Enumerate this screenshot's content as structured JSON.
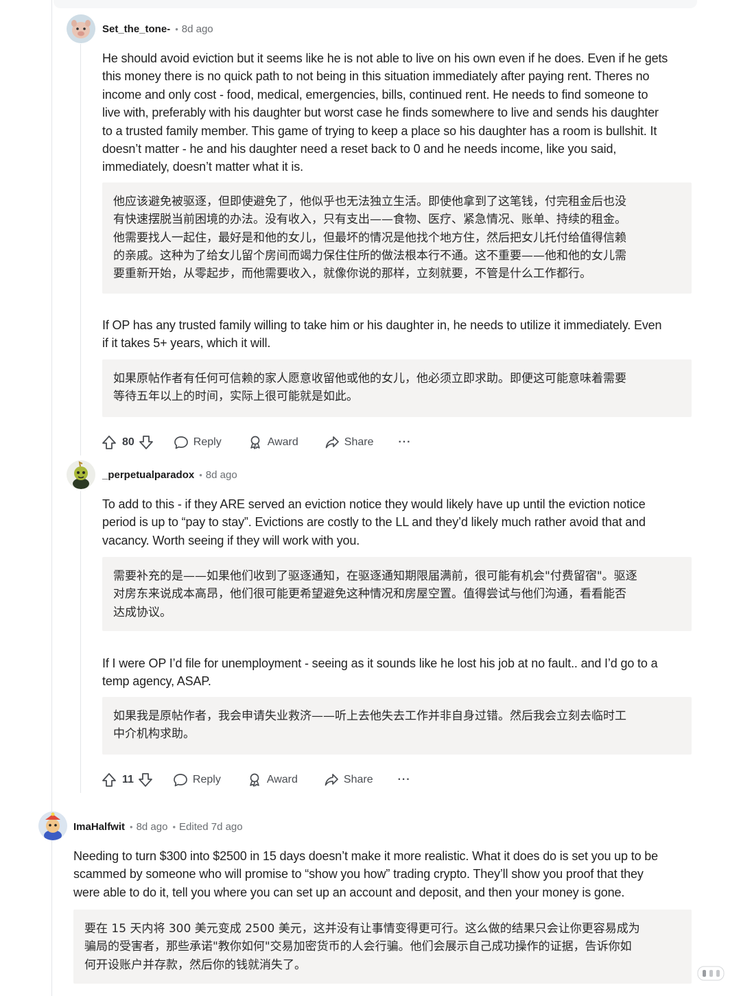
{
  "comments": [
    {
      "username": "Set_the_tone-",
      "separator": "•",
      "time": "8d ago",
      "paragraphs": [
        {
          "lines": [
            "He should avoid eviction but it seems like he is not able to live on his own even if he does. Even if he gets",
            "this money there is no quick path to not being in this situation immediately after paying rent. Theres no",
            "income and only cost - food, medical, emergencies, bills, continued rent. He needs to find someone to",
            "live with, preferably with his daughter but worst case he finds somewhere to live and sends his daughter",
            "to a trusted family member. This game of trying to keep a place so his daughter has a room is bullshit. It",
            "doesn’t matter - he and his daughter need a reset back to 0 and he needs income, like you said,",
            "immediately, doesn’t matter what it is."
          ],
          "translation": [
            "他应该避免被驱逐，但即使避免了，他似乎也无法独立生活。即使他拿到了这笔钱，付完租金后也没",
            "有快速摆脱当前困境的办法。没有收入，只有支出——食物、医疗、紧急情况、账单、持续的租金。",
            "他需要找人一起住，最好是和他的女儿，但最坏的情况是他找个地方住，然后把女儿托付给值得信赖",
            "的亲戚。这种为了给女儿留个房间而竭力保住住所的做法根本行不通。这不重要——他和他的女儿需",
            "要重新开始，从零起步，而他需要收入，就像你说的那样，立刻就要，不管是什么工作都行。"
          ]
        },
        {
          "lines": [
            "If OP has any trusted family willing to take him or his daughter in, he needs to utilize it immediately. Even",
            "if it takes 5+ years, which it will."
          ],
          "translation": [
            "如果原帖作者有任何可信赖的家人愿意收留他或他的女儿，他必须立即求助。即便这可能意味着需要",
            "等待五年以上的时间，实际上很可能就是如此。"
          ]
        }
      ],
      "votes": "80",
      "actions": {
        "reply": "Reply",
        "award": "Award",
        "share": "Share",
        "more": "···"
      }
    },
    {
      "username": "_perpetualparadox",
      "separator": "•",
      "time": "8d ago",
      "paragraphs": [
        {
          "lines": [
            "To add to this - if they ARE served an eviction notice they would likely have up until the eviction notice",
            "period is up to “pay to stay”. Evictions are costly to the LL and they’d likely much rather avoid that and",
            "vacancy. Worth seeing if they will work with you."
          ],
          "translation": [
            "需要补充的是——如果他们收到了驱逐通知，在驱逐通知期限届满前，很可能有机会\"付费留宿\"。驱逐",
            "对房东来说成本高昂，他们很可能更希望避免这种情况和房屋空置。值得尝试与他们沟通，看看能否",
            "达成协议。"
          ]
        },
        {
          "lines": [
            "If I were OP I’d file for unemployment - seeing as it sounds like he lost his job at no fault.. and I’d go to a",
            "temp agency, ASAP."
          ],
          "translation": [
            "如果我是原帖作者，我会申请失业救济——听上去他失去工作并非自身过错。然后我会立刻去临时工",
            "中介机构求助。"
          ]
        }
      ],
      "votes": "11",
      "actions": {
        "reply": "Reply",
        "award": "Award",
        "share": "Share",
        "more": "···"
      }
    },
    {
      "username": "ImaHalfwit",
      "separator": "•",
      "time": "8d ago",
      "edited": "Edited 7d ago",
      "paragraphs": [
        {
          "lines": [
            "Needing to turn $300 into $2500 in 15 days doesn’t make it more realistic. What it does do is set you up to be",
            "scammed by someone who will promise to “show you how” trading crypto. They’ll show you proof that they",
            "were able to do it, tell you where you can set up an account and deposit, and then your money is gone."
          ],
          "translation": [
            "要在 15 天内将 300 美元变成 2500 美元，这并没有让事情变得更可行。这么做的结果只会让你更容易成为",
            "骗局的受害者，那些承诺\"教你如何\"交易加密货币的人会行骗。他们会展示自己成功操作的证据，告诉你如",
            "何开设账户并存款，然后你的钱就消失了。"
          ]
        }
      ]
    }
  ],
  "icons": [
    "upvote-icon",
    "downvote-icon",
    "comment-icon",
    "award-icon",
    "share-icon",
    "more-icon"
  ]
}
